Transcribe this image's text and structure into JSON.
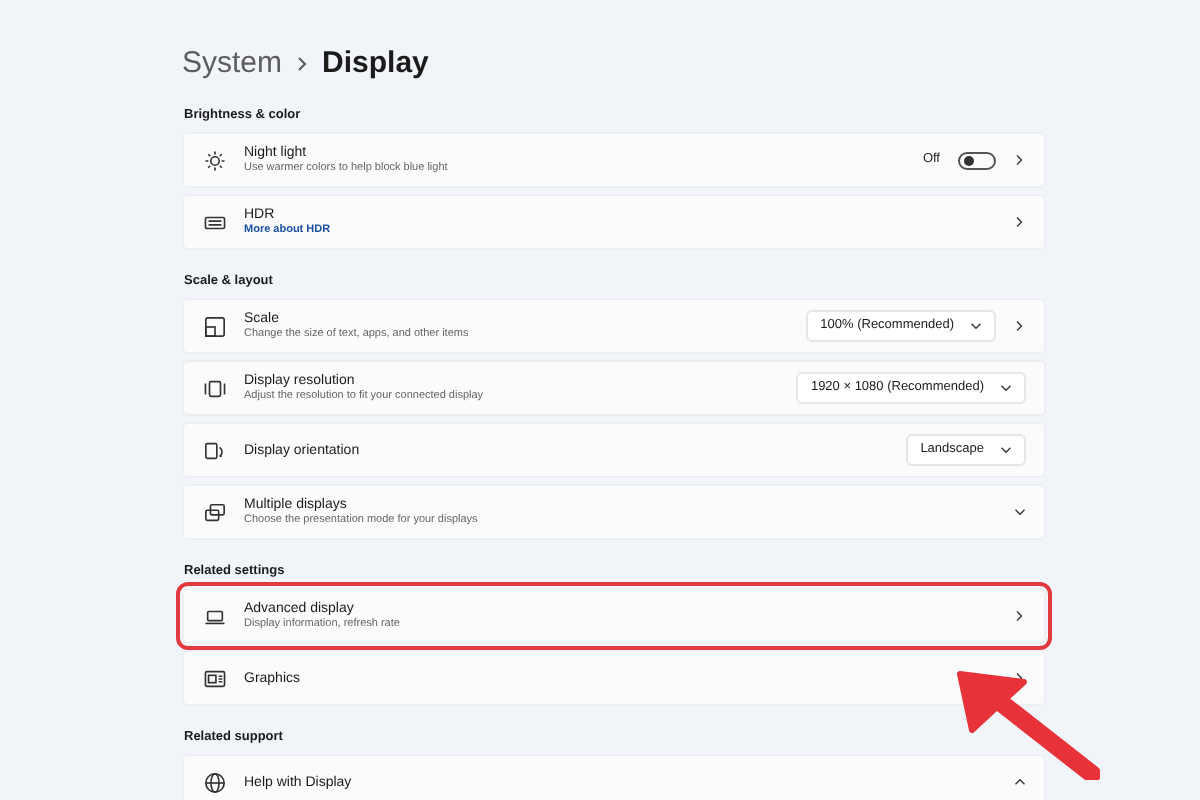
{
  "breadcrumb": [
    {
      "label": "System",
      "current": false
    },
    {
      "label": "Display",
      "current": true
    }
  ],
  "sections": [
    {
      "title": "Brightness & color",
      "items": [
        {
          "title": "Night light",
          "subtitle": "Use warmer colors to help block blue light",
          "toggle": {
            "label": "Off",
            "on": false
          },
          "navigates": true
        },
        {
          "title": "HDR",
          "link": "More about HDR",
          "navigates": true
        }
      ]
    },
    {
      "title": "Scale & layout",
      "items": [
        {
          "title": "Scale",
          "subtitle": "Change the size of text, apps, and other items",
          "value": "100% (Recommended)",
          "navigates": true
        },
        {
          "title": "Display resolution",
          "subtitle": "Adjust the resolution to fit your connected display",
          "value": "1920 × 1080 (Recommended)"
        },
        {
          "title": "Display orientation",
          "value": "Landscape"
        },
        {
          "title": "Multiple displays",
          "subtitle": "Choose the presentation mode for your displays",
          "expanded": false
        }
      ]
    },
    {
      "title": "Related settings",
      "items": [
        {
          "title": "Advanced display",
          "subtitle": "Display information, refresh rate",
          "navigates": true,
          "highlighted": true
        },
        {
          "title": "Graphics",
          "navigates": true
        }
      ]
    },
    {
      "title": "Related support",
      "items": [
        {
          "title": "Help with Display",
          "expanded": true
        }
      ]
    }
  ],
  "pointer_arrow": true
}
